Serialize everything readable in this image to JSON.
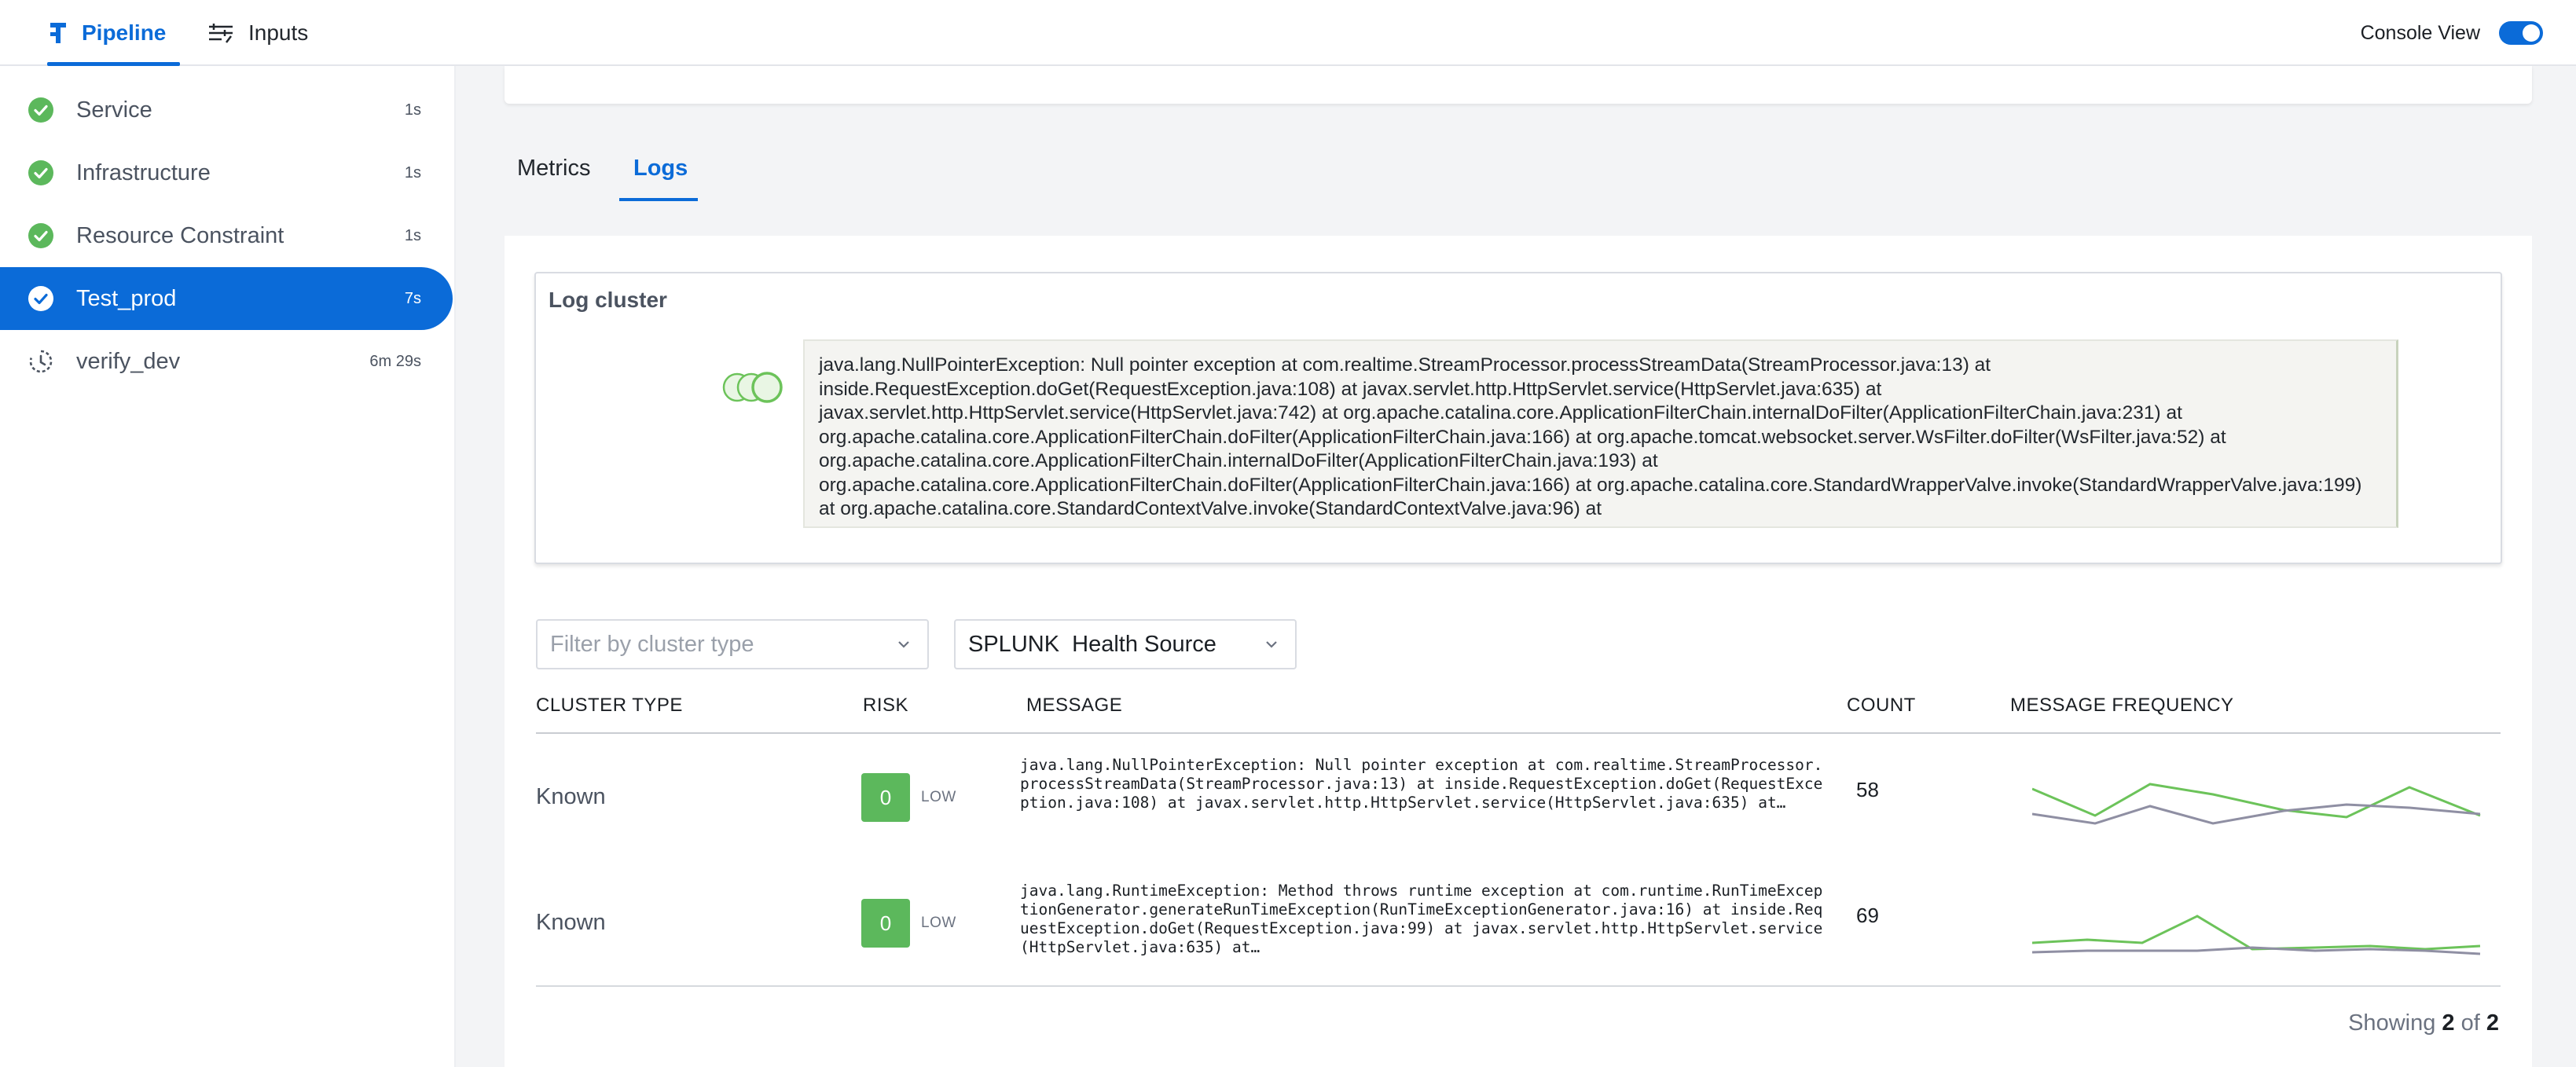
{
  "topbar": {
    "tabs": [
      {
        "label": "Pipeline",
        "active": true,
        "icon": "pipeline-icon"
      },
      {
        "label": "Inputs",
        "active": false,
        "icon": "inputs-sliders-icon"
      }
    ],
    "console_view_label": "Console View",
    "console_view_enabled": true
  },
  "sidebar": {
    "steps": [
      {
        "label": "Service",
        "time": "1s",
        "status": "success"
      },
      {
        "label": "Infrastructure",
        "time": "1s",
        "status": "success"
      },
      {
        "label": "Resource Constraint",
        "time": "1s",
        "status": "success"
      },
      {
        "label": "Test_prod",
        "time": "7s",
        "status": "success",
        "active": true
      },
      {
        "label": "verify_dev",
        "time": "6m 29s",
        "status": "running"
      }
    ]
  },
  "main": {
    "tabs": [
      {
        "label": "Metrics",
        "active": false
      },
      {
        "label": "Logs",
        "active": true
      }
    ],
    "log_cluster": {
      "title": "Log cluster",
      "tooltip": "java.lang.NullPointerException: Null pointer exception at com.realtime.StreamProcessor.processStreamData(StreamProcessor.java:13) at inside.RequestException.doGet(RequestException.java:108) at javax.servlet.http.HttpServlet.service(HttpServlet.java:635) at javax.servlet.http.HttpServlet.service(HttpServlet.java:742) at org.apache.catalina.core.ApplicationFilterChain.internalDoFilter(ApplicationFilterChain.java:231) at org.apache.catalina.core.ApplicationFilterChain.doFilter(ApplicationFilterChain.java:166) at org.apache.tomcat.websocket.server.WsFilter.doFilter(WsFilter.java:52) at org.apache.catalina.core.ApplicationFilterChain.internalDoFilter(ApplicationFilterChain.java:193) at org.apache.catalina.core.ApplicationFilterChain.doFilter(ApplicationFilterChain.java:166) at org.apache.catalina.core.StandardWrapperValve.invoke(StandardWrapperValve.java:199) at org.apache.catalina.core.StandardContextValve.invoke(StandardContextValve.java:96) at"
    },
    "filters": {
      "cluster_type_placeholder": "Filter by cluster type",
      "health_source_value": "SPLUNK  Health Source"
    },
    "table": {
      "headers": [
        "CLUSTER TYPE",
        "RISK",
        "MESSAGE",
        "COUNT",
        "MESSAGE FREQUENCY"
      ],
      "rows": [
        {
          "cluster_type": "Known",
          "risk_score": "0",
          "risk_level": "LOW",
          "message": "java.lang.NullPointerException: Null pointer exception at com.realtime.StreamProcessor.processStreamData(StreamProcessor.java:13) at inside.RequestException.doGet(RequestException.java:108) at javax.servlet.http.HttpServlet.service(HttpServlet.java:635) at…",
          "count": "58"
        },
        {
          "cluster_type": "Known",
          "risk_score": "0",
          "risk_level": "LOW",
          "message": "java.lang.RuntimeException: Method throws runtime exception at com.runtime.RunTimeExceptionGenerator.generateRunTimeException(RunTimeExceptionGenerator.java:16) at inside.RequestException.doGet(RequestException.java:99) at javax.servlet.http.HttpServlet.service(HttpServlet.java:635) at…",
          "count": "69"
        }
      ]
    },
    "pagination": {
      "prefix": "Showing",
      "shown": "2",
      "of": "of",
      "total": "2"
    },
    "colors": {
      "accent": "#0b6bd8",
      "success": "#5cb85c",
      "spark_test": "#6cc35a",
      "spark_control": "#8f8fa3"
    }
  }
}
